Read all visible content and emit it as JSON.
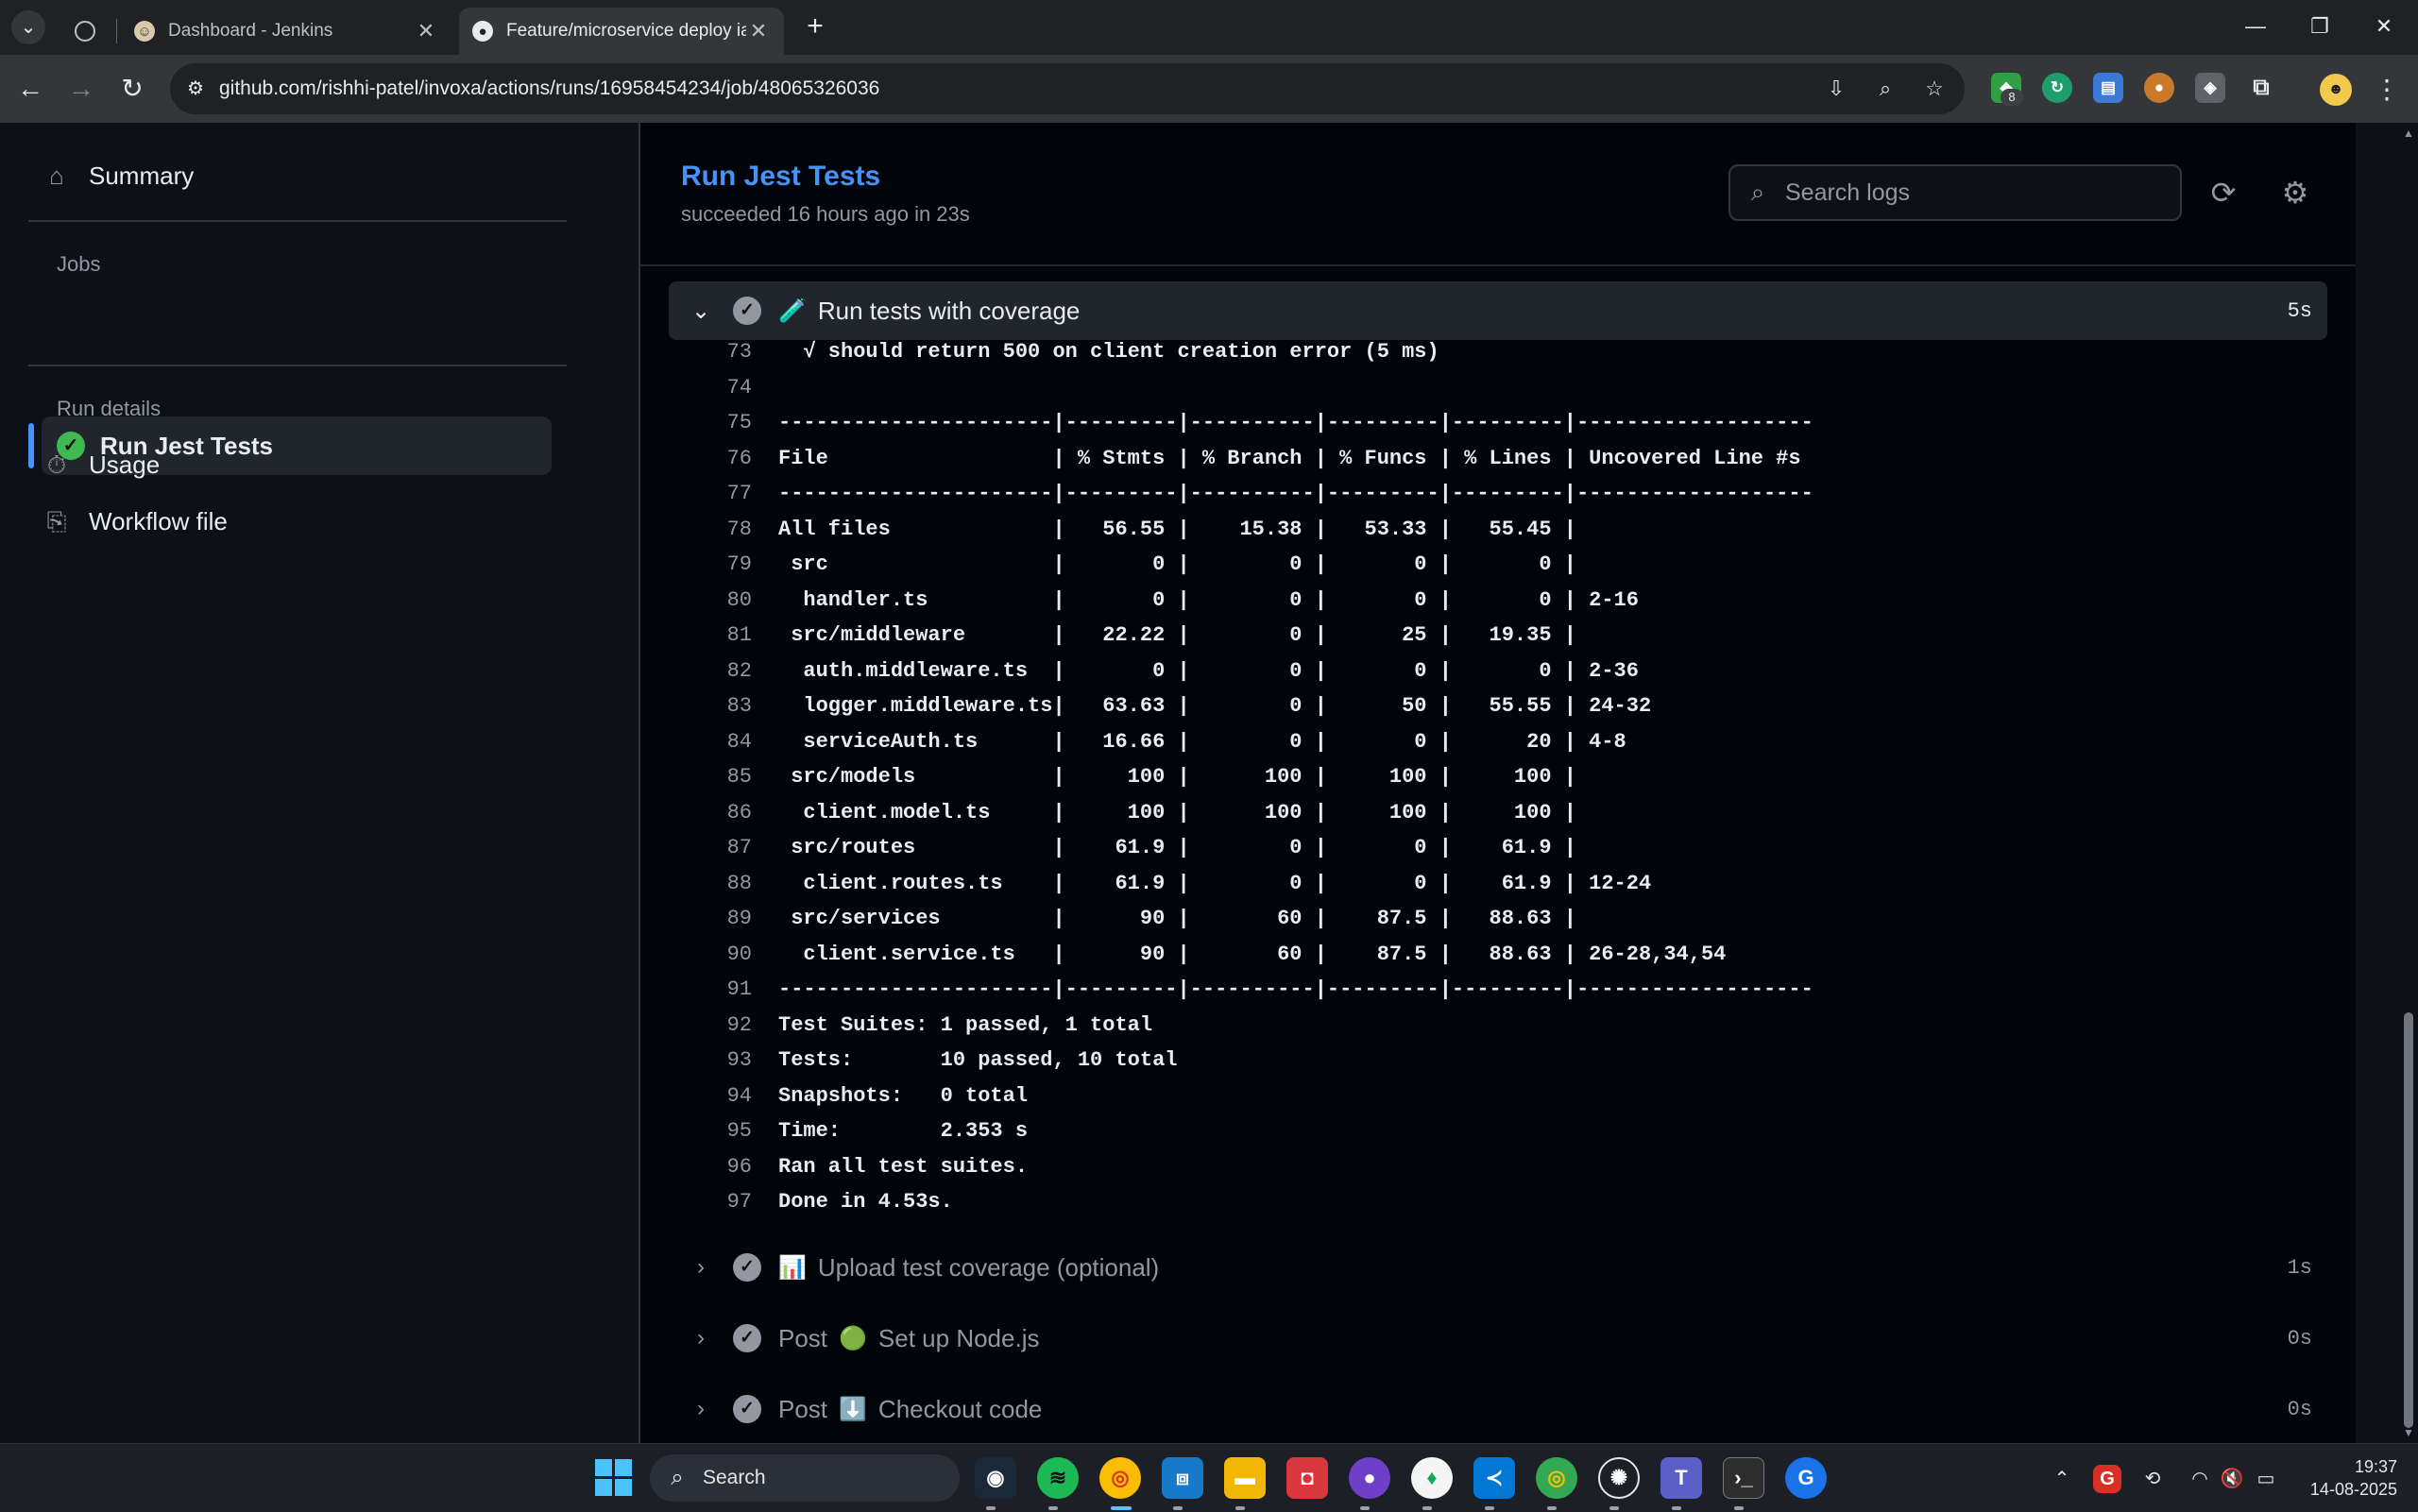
{
  "browser": {
    "tabs": [
      {
        "title": "Dashboard - Jenkins",
        "active": false
      },
      {
        "title": "Feature/microservice deploy iac",
        "active": true
      }
    ],
    "new_tab": "+",
    "url": "github.com/rishhi-patel/invoxa/actions/runs/16958454234/job/48065326036",
    "extension_badge": "8"
  },
  "sidebar": {
    "summary": "Summary",
    "jobs_heading": "Jobs",
    "active_job": "Run Jest Tests",
    "run_details_heading": "Run details",
    "usage": "Usage",
    "workflow_file": "Workflow file"
  },
  "job": {
    "title": "Run Jest Tests",
    "subtitle": "succeeded 16 hours ago in 23s",
    "search_placeholder": "Search logs"
  },
  "expanded_step": {
    "emoji": "🧪",
    "name": "Run tests with coverage",
    "duration": "5s"
  },
  "log_lines": [
    {
      "n": "73",
      "t": "  √ should return 500 on client creation error (5 ms)"
    },
    {
      "n": "74",
      "t": ""
    },
    {
      "n": "75",
      "t": "----------------------|---------|----------|---------|---------|-------------------"
    },
    {
      "n": "76",
      "t": "File                  | % Stmts | % Branch | % Funcs | % Lines | Uncovered Line #s"
    },
    {
      "n": "77",
      "t": "----------------------|---------|----------|---------|---------|-------------------"
    },
    {
      "n": "78",
      "t": "All files             |   56.55 |    15.38 |   53.33 |   55.45 |"
    },
    {
      "n": "79",
      "t": " src                  |       0 |        0 |       0 |       0 |"
    },
    {
      "n": "80",
      "t": "  handler.ts          |       0 |        0 |       0 |       0 | 2-16"
    },
    {
      "n": "81",
      "t": " src/middleware       |   22.22 |        0 |      25 |   19.35 |"
    },
    {
      "n": "82",
      "t": "  auth.middleware.ts  |       0 |        0 |       0 |       0 | 2-36"
    },
    {
      "n": "83",
      "t": "  logger.middleware.ts|   63.63 |        0 |      50 |   55.55 | 24-32"
    },
    {
      "n": "84",
      "t": "  serviceAuth.ts      |   16.66 |        0 |       0 |      20 | 4-8"
    },
    {
      "n": "85",
      "t": " src/models           |     100 |      100 |     100 |     100 |"
    },
    {
      "n": "86",
      "t": "  client.model.ts     |     100 |      100 |     100 |     100 |"
    },
    {
      "n": "87",
      "t": " src/routes           |    61.9 |        0 |       0 |    61.9 |"
    },
    {
      "n": "88",
      "t": "  client.routes.ts    |    61.9 |        0 |       0 |    61.9 | 12-24"
    },
    {
      "n": "89",
      "t": " src/services         |      90 |       60 |    87.5 |   88.63 |"
    },
    {
      "n": "90",
      "t": "  client.service.ts   |      90 |       60 |    87.5 |   88.63 | 26-28,34,54"
    },
    {
      "n": "91",
      "t": "----------------------|---------|----------|---------|---------|-------------------"
    },
    {
      "n": "92",
      "t": "Test Suites: 1 passed, 1 total"
    },
    {
      "n": "93",
      "t": "Tests:       10 passed, 10 total"
    },
    {
      "n": "94",
      "t": "Snapshots:   0 total"
    },
    {
      "n": "95",
      "t": "Time:        2.353 s"
    },
    {
      "n": "96",
      "t": "Ran all test suites."
    },
    {
      "n": "97",
      "t": "Done in 4.53s."
    }
  ],
  "collapsed_steps": [
    {
      "prefix": "",
      "emoji": "📊",
      "name": "Upload test coverage (optional)",
      "duration": "1s"
    },
    {
      "prefix": "Post",
      "emoji": "🟢",
      "name": "Set up Node.js",
      "duration": "0s"
    },
    {
      "prefix": "Post",
      "emoji": "⬇️",
      "name": "Checkout code",
      "duration": "0s"
    }
  ],
  "taskbar": {
    "search_label": "Search",
    "time": "19:37",
    "date": "14-08-2025"
  },
  "colors": {
    "accent": "#4493f8",
    "success": "#3fb950",
    "page_bg": "#0d1117",
    "log_bg": "#010409"
  }
}
